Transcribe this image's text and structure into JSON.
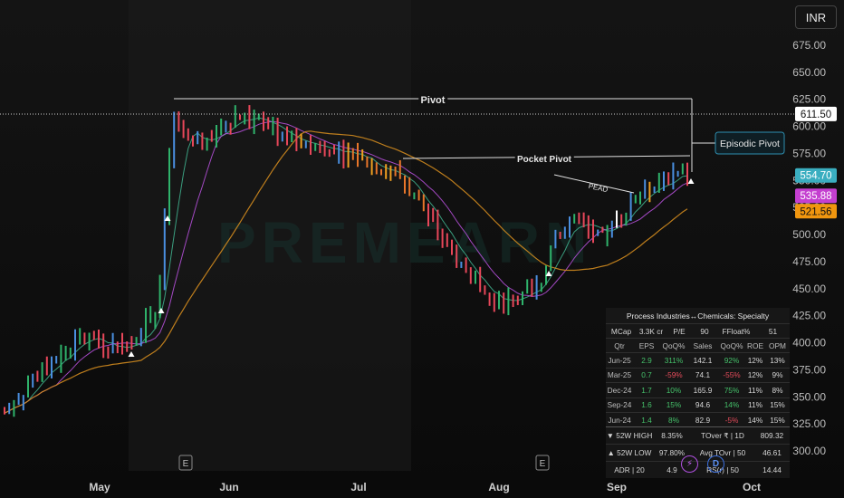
{
  "currency": "INR",
  "colors": {
    "up": "#2fb36b",
    "down": "#e8475a",
    "pivot_line": "#e0e0e0",
    "ma_fast": "#3fae8c",
    "ma_mid": "#b24fd6",
    "ma_slow": "#d08a1e",
    "last_price_badge": "#ffffff",
    "ema_badge": "#3aaec0",
    "ma_badge": "#c43fd0",
    "slow_badge": "#f0960f"
  },
  "chart_data": {
    "type": "candlestick",
    "y_ticks": [
      "675.00",
      "650.00",
      "625.00",
      "600.00",
      "575.00",
      "550.00",
      "525.00",
      "500.00",
      "475.00",
      "450.00",
      "425.00",
      "400.00",
      "375.00",
      "350.00",
      "325.00",
      "300.00"
    ],
    "ylim": [
      290,
      690
    ],
    "x_ticks": [
      "May",
      "Jun",
      "Jul",
      "Aug",
      "Sep",
      "Oct"
    ],
    "price_labels": {
      "last": "611.50",
      "ema": "554.70",
      "ma": "535.88",
      "ma_slow": "521.56"
    },
    "annotations": {
      "pivot": "Pivot",
      "pocket_pivot": "Pocket Pivot",
      "episodic_pivot": "Episodic Pivot",
      "pead": "PEAD",
      "earnings_marker": "E"
    },
    "watermark": "PREMEARN"
  },
  "table": {
    "sector": "Process Industries↔Chemicals: Specialty",
    "mcap": [
      "MCap",
      "3.3K cr",
      "P/E",
      "90",
      "FFloat%",
      "51"
    ],
    "headers": [
      "Qtr",
      "EPS",
      "QoQ%",
      "Sales",
      "QoQ%",
      "ROE",
      "OPM"
    ],
    "rows": [
      [
        "Jun-25",
        "2.9",
        "311%",
        "142.1",
        "92%",
        "12%",
        "13%"
      ],
      [
        "Mar-25",
        "0.7",
        "-59%",
        "74.1",
        "-55%",
        "12%",
        "9%"
      ],
      [
        "Dec-24",
        "1.7",
        "10%",
        "165.9",
        "75%",
        "11%",
        "8%"
      ],
      [
        "Sep-24",
        "1.6",
        "15%",
        "94.6",
        "14%",
        "11%",
        "15%"
      ],
      [
        "Jun-24",
        "1.4",
        "8%",
        "82.9",
        "-5%",
        "14%",
        "15%"
      ]
    ],
    "stats": [
      [
        "▼ 52W HIGH",
        "8.35%",
        "TOver ₹ | 1D",
        "809.32"
      ],
      [
        "▲ 52W LOW",
        "97.80%",
        "Avg TOvr | 50",
        "46.61"
      ],
      [
        "ADR | 20",
        "4.9",
        "RS(r) | 50",
        "14.44"
      ]
    ]
  }
}
